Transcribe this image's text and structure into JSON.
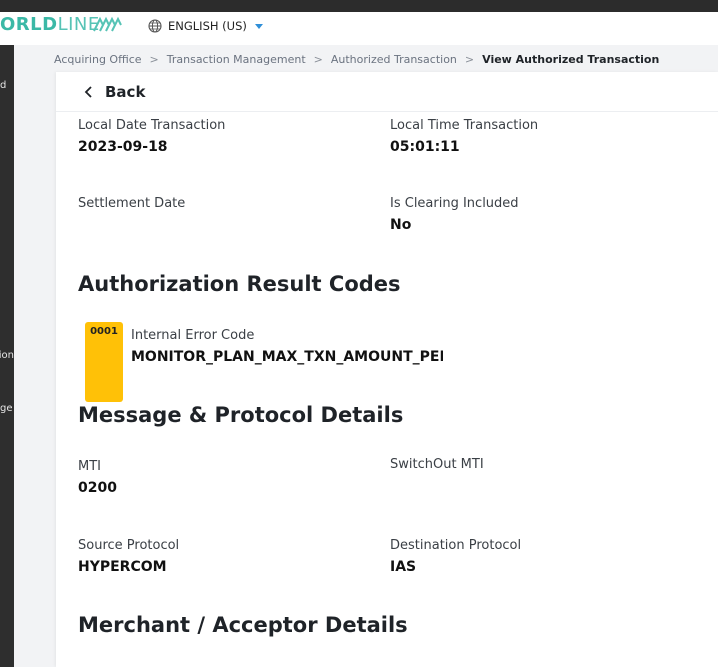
{
  "header": {
    "logo_main": "ORLD",
    "logo_line": "LINE",
    "language": "ENGLISH (US)"
  },
  "sidebar": {
    "fragments": [
      "d",
      "ion",
      "ge"
    ]
  },
  "breadcrumb": {
    "items": [
      "Acquiring Office",
      "Transaction Management",
      "Authorized Transaction",
      "View Authorized Transaction"
    ],
    "separator": ">"
  },
  "back": {
    "label": "Back"
  },
  "transaction": {
    "local_date_label": "Local Date Transaction",
    "local_date_value": "2023-09-18",
    "local_time_label": "Local Time Transaction",
    "local_time_value": "05:01:11",
    "settlement_label": "Settlement Date",
    "settlement_value": "",
    "clearing_label": "Is Clearing Included",
    "clearing_value": "No"
  },
  "auth_result": {
    "title": "Authorization Result Codes",
    "code": "0001",
    "error_label": "Internal Error Code",
    "error_value": "MONITOR_PLAN_MAX_TXN_AMOUNT_PER_M"
  },
  "message_protocol": {
    "title": "Message & Protocol Details",
    "mti_label": "MTI",
    "mti_value": "0200",
    "switchout_label": "SwitchOut MTI",
    "switchout_value": "",
    "source_label": "Source Protocol",
    "source_value": "HYPERCOM",
    "dest_label": "Destination Protocol",
    "dest_value": "IAS"
  },
  "merchant": {
    "title": "Merchant / Acceptor Details"
  },
  "colors": {
    "brand": "#3bb8a6",
    "badge": "#ffc107",
    "sidebar": "#2e2e2e",
    "caret": "#2f8fd8"
  }
}
